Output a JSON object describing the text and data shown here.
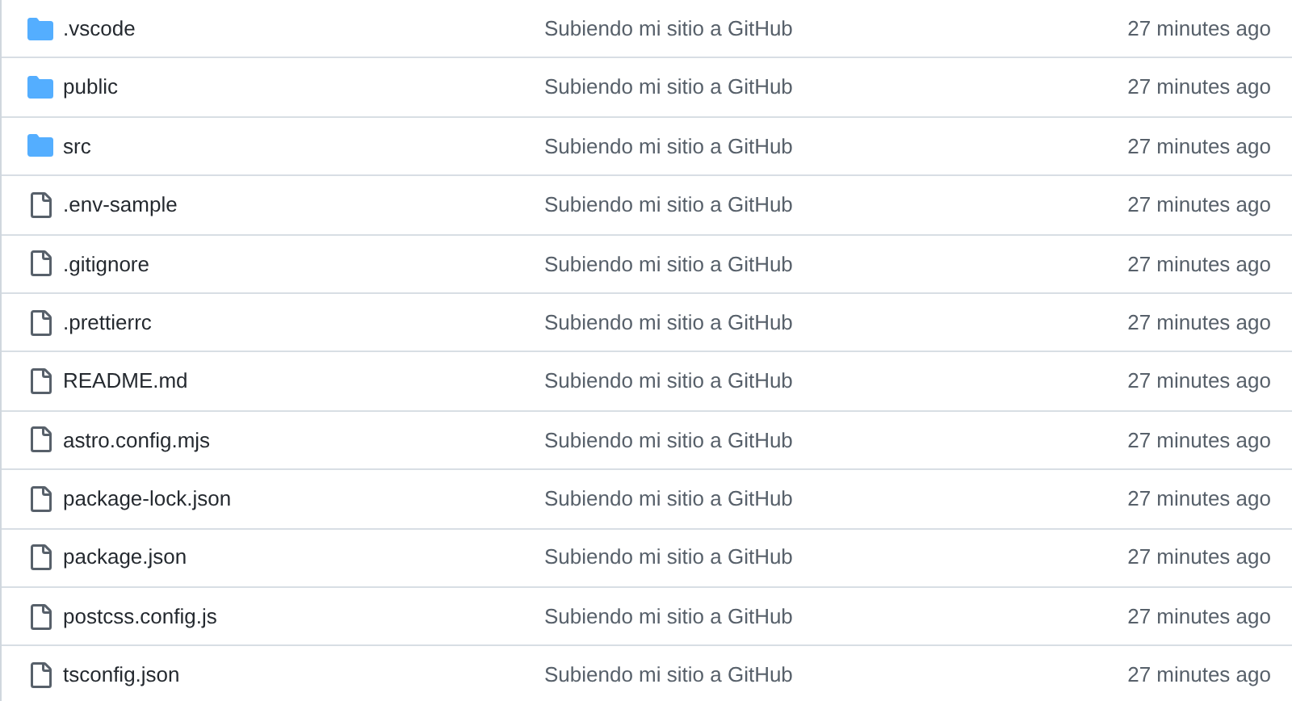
{
  "files": [
    {
      "kind": "folder",
      "name": ".vscode",
      "message": "Subiendo mi sitio a GitHub",
      "time": "27 minutes ago"
    },
    {
      "kind": "folder",
      "name": "public",
      "message": "Subiendo mi sitio a GitHub",
      "time": "27 minutes ago"
    },
    {
      "kind": "folder",
      "name": "src",
      "message": "Subiendo mi sitio a GitHub",
      "time": "27 minutes ago"
    },
    {
      "kind": "file",
      "name": ".env-sample",
      "message": "Subiendo mi sitio a GitHub",
      "time": "27 minutes ago"
    },
    {
      "kind": "file",
      "name": ".gitignore",
      "message": "Subiendo mi sitio a GitHub",
      "time": "27 minutes ago"
    },
    {
      "kind": "file",
      "name": ".prettierrc",
      "message": "Subiendo mi sitio a GitHub",
      "time": "27 minutes ago"
    },
    {
      "kind": "file",
      "name": "README.md",
      "message": "Subiendo mi sitio a GitHub",
      "time": "27 minutes ago"
    },
    {
      "kind": "file",
      "name": "astro.config.mjs",
      "message": "Subiendo mi sitio a GitHub",
      "time": "27 minutes ago"
    },
    {
      "kind": "file",
      "name": "package-lock.json",
      "message": "Subiendo mi sitio a GitHub",
      "time": "27 minutes ago"
    },
    {
      "kind": "file",
      "name": "package.json",
      "message": "Subiendo mi sitio a GitHub",
      "time": "27 minutes ago"
    },
    {
      "kind": "file",
      "name": "postcss.config.js",
      "message": "Subiendo mi sitio a GitHub",
      "time": "27 minutes ago"
    },
    {
      "kind": "file",
      "name": "tsconfig.json",
      "message": "Subiendo mi sitio a GitHub",
      "time": "27 minutes ago"
    }
  ]
}
